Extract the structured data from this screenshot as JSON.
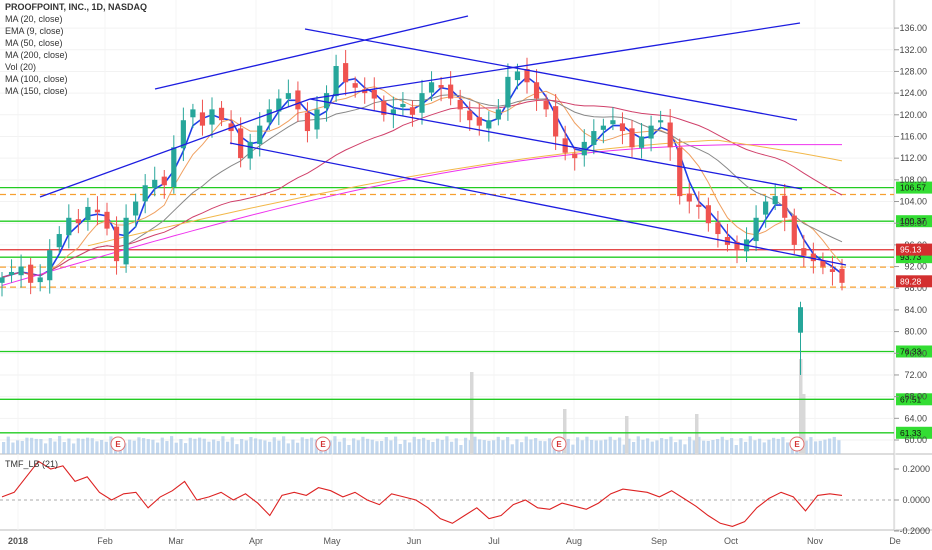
{
  "legend": {
    "title": "PROOFPOINT, INC., 1D, NASDAQ",
    "lines": [
      "MA (20, close)",
      "EMA (9, close)",
      "MA (50, close)",
      "MA (200, close)",
      "Vol (20)",
      "MA (100, close)",
      "MA (150, close)"
    ]
  },
  "indicator_label": "TMF_LB (21)",
  "colors": {
    "up": "#26a69a",
    "down": "#ef5350",
    "channel": "#1d1de0",
    "support": "#22cc22",
    "dashed": "#f7a030",
    "ema9": "#1f3ee8",
    "ma20": "#f0a060",
    "ma50": "#888888",
    "ma100": "#d0406a",
    "ma150": "#ee33ee",
    "ma200": "#f2b84a",
    "volume": "#aac8e8",
    "tmf": "#dd2222",
    "price_tag": "#d32f2f"
  },
  "chart_data": {
    "type": "candlestick",
    "title": "PROOFPOINT, INC., 1D, NASDAQ",
    "ylim": [
      58,
      137
    ],
    "y_ticks": [
      "136.00",
      "132.00",
      "128.00",
      "124.00",
      "120.00",
      "116.00",
      "112.00",
      "108.00",
      "104.00",
      "100.00",
      "96.00",
      "92.00",
      "88.00",
      "84.00",
      "80.00",
      "76.00",
      "72.00",
      "68.00",
      "64.00",
      "60.00"
    ],
    "x_ticks": [
      "2018",
      "Feb",
      "Mar",
      "Apr",
      "May",
      "Jun",
      "Jul",
      "Aug",
      "Sep",
      "Oct",
      "Nov",
      "De"
    ],
    "horizontal_levels": [
      {
        "label": "106.57",
        "value": 106.57,
        "style": "solid-green"
      },
      {
        "label": "100.37",
        "value": 100.37,
        "style": "solid-green"
      },
      {
        "label": "93.73",
        "value": 93.73,
        "style": "solid-green"
      },
      {
        "label": "76.33",
        "value": 76.33,
        "style": "solid-green"
      },
      {
        "label": "67.51",
        "value": 67.51,
        "style": "solid-green"
      },
      {
        "label": "61.33",
        "value": 61.33,
        "style": "solid-green"
      },
      {
        "label": "",
        "value": 105.3,
        "style": "dashed-orange"
      },
      {
        "label": "",
        "value": 91.9,
        "style": "dashed-orange"
      },
      {
        "label": "",
        "value": 88.2,
        "style": "dashed-orange"
      },
      {
        "label": "",
        "value": 95.1,
        "style": "solid-red"
      }
    ],
    "current_price_tags": [
      {
        "label": "95.13",
        "value": 95.13
      },
      {
        "label": "89.28",
        "value": 89.28
      }
    ],
    "earnings_markers": [
      "Feb",
      "May",
      "Aug",
      "Oct"
    ],
    "closes": [
      90,
      91,
      92,
      89,
      90,
      95,
      98,
      101,
      100,
      103,
      102,
      99,
      93,
      101,
      104,
      107,
      108,
      107,
      114,
      119,
      121,
      118,
      121,
      119,
      117,
      112,
      115,
      118,
      121,
      123,
      124,
      121,
      117,
      121,
      124,
      129,
      126,
      125,
      124,
      123,
      120,
      121,
      122,
      120,
      124,
      126,
      125,
      123,
      121,
      119,
      118,
      119,
      121,
      127,
      128,
      126,
      123,
      121,
      116,
      113,
      112,
      115,
      117,
      118,
      119,
      117,
      114,
      116,
      118,
      119,
      114,
      105,
      104,
      103,
      100,
      98,
      96,
      95,
      97,
      101,
      104,
      105,
      101,
      96,
      94,
      93,
      92,
      91,
      89
    ],
    "tmf_label": "TMF_LB (21)",
    "tmf_ticks": [
      "0.2000",
      "0.0000",
      "-0.2000"
    ],
    "tmf_values": [
      0.02,
      0.05,
      0.15,
      0.25,
      0.2,
      0.22,
      0.12,
      0.15,
      0.05,
      0.0,
      0.04,
      0.05,
      -0.05,
      0.02,
      0.06,
      0.12,
      0.0,
      0.02,
      0.05,
      0.0,
      0.04,
      -0.02,
      -0.1,
      0.03,
      0.05,
      0.03,
      0.08,
      0.06,
      0.02,
      0.05,
      0.0,
      -0.03,
      0.04,
      0.02,
      0.0,
      -0.05,
      -0.12,
      -0.15,
      -0.1,
      -0.05,
      -0.12,
      -0.1,
      -0.03,
      0.0,
      -0.05,
      -0.06,
      -0.02,
      -0.04,
      -0.06,
      -0.02,
      0.04,
      0.07,
      0.06,
      0.05,
      0.02,
      0.06,
      0.01,
      -0.04,
      -0.1,
      -0.15,
      -0.17,
      -0.14,
      -0.05,
      0.01,
      0.05,
      0.02,
      -0.07,
      0.03,
      0.04,
      0.03
    ]
  }
}
